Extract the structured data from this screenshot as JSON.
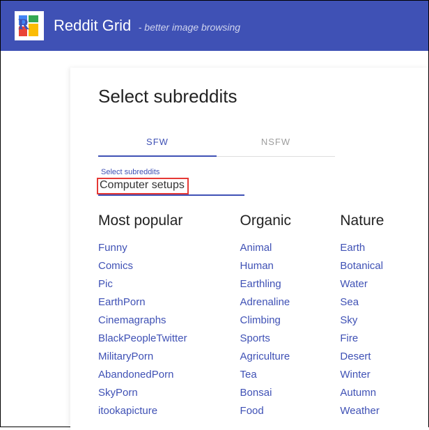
{
  "header": {
    "title": "Reddit Grid",
    "subtitle": "- better image browsing"
  },
  "page": {
    "heading": "Select subreddits"
  },
  "tabs": {
    "sfw": "SFW",
    "nsfw": "NSFW"
  },
  "input": {
    "label": "Select subreddits",
    "value": "Computer setups"
  },
  "columns": [
    {
      "title": "Most popular",
      "items": [
        "Funny",
        "Comics",
        "Pic",
        "EarthPorn",
        "Cinemagraphs",
        "BlackPeopleTwitter",
        "MilitaryPorn",
        "AbandonedPorn",
        "SkyPorn",
        "itookapicture"
      ]
    },
    {
      "title": "Organic",
      "items": [
        "Animal",
        "Human",
        "Earthling",
        "Adrenaline",
        "Climbing",
        "Sports",
        "Agriculture",
        "Tea",
        "Bonsai",
        "Food"
      ]
    },
    {
      "title": "Nature",
      "items": [
        "Earth",
        "Botanical",
        "Water",
        "Sea",
        "Sky",
        "Fire",
        "Desert",
        "Winter",
        "Autumn",
        "Weather"
      ]
    }
  ]
}
